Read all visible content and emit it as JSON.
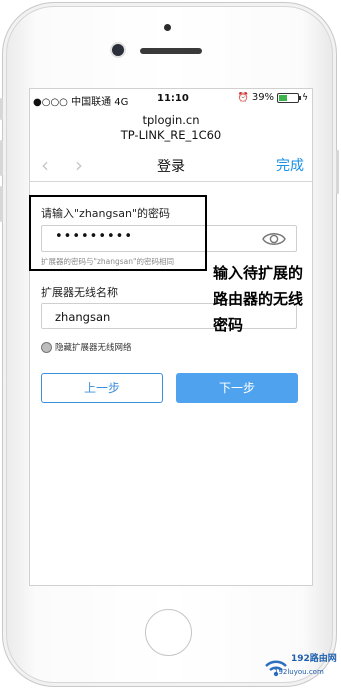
{
  "status_bar": {
    "carrier": "●○○○ 中国联通  4G",
    "time": "11:10",
    "alarm": "⏰",
    "battery_text": "39%",
    "battery_level": 0.39,
    "charging": "ϟ"
  },
  "browser": {
    "host": "tplogin.cn",
    "page_title": "TP-LINK_RE_1C60"
  },
  "nav": {
    "back": "‹",
    "forward": "›",
    "title": "登录",
    "done": "完成"
  },
  "form": {
    "password_label": "请输入\"zhangsan\"的密码",
    "password_value": "•••••••••",
    "password_hint": "扩展器的密码与\"zhangsan\"的密码相同",
    "ssid_label": "扩展器无线名称",
    "ssid_value": "zhangsan",
    "hide_ssid_label": "隐藏扩展器无线网络"
  },
  "buttons": {
    "prev": "上一步",
    "next": "下一步"
  },
  "annotation": {
    "text": "输入待扩展的路由器的无线密码"
  },
  "watermark": {
    "brand": "192路由网",
    "url": "192luyou.com"
  },
  "colors": {
    "accent": "#1a8fe3",
    "next_button": "#4fa3ee"
  }
}
